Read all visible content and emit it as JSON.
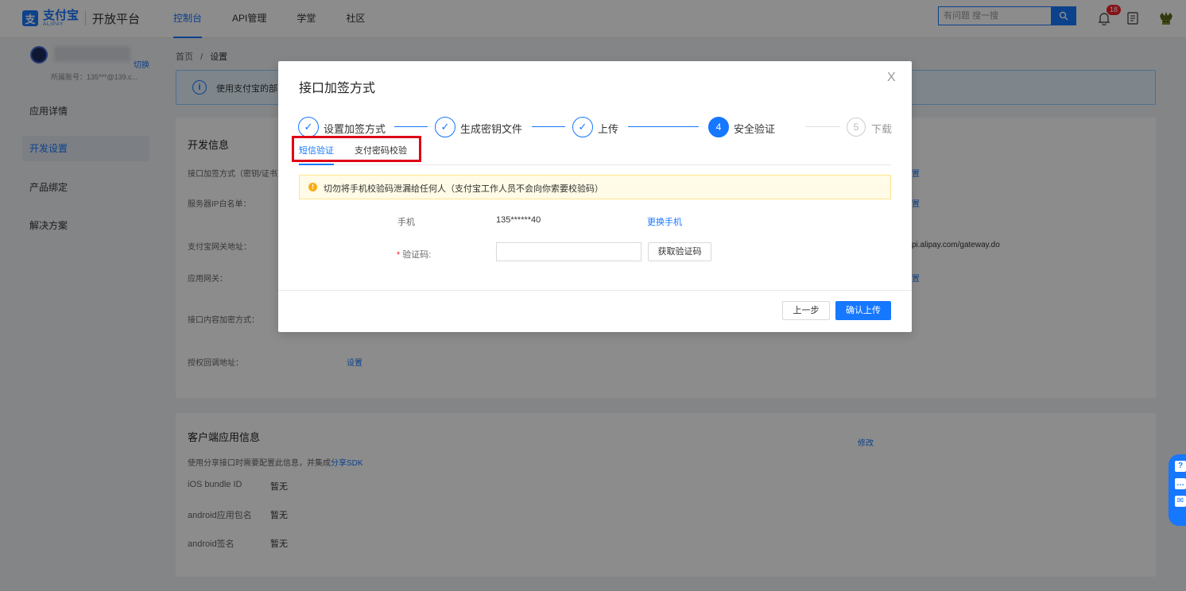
{
  "header": {
    "logo_cn": "支付宝",
    "logo_en": "ALIPAY",
    "platform": "开放平台",
    "nav": [
      "控制台",
      "API管理",
      "学堂",
      "社区"
    ],
    "search_placeholder": "有问题 搜一搜",
    "notification_count": "18"
  },
  "sidebar": {
    "switch": "切换",
    "account": "所属账号：135***@139.c...",
    "items": [
      "应用详情",
      "开发设置",
      "产品绑定",
      "解决方案"
    ]
  },
  "main": {
    "breadcrumb_home": "首页",
    "breadcrumb_sep": "/",
    "breadcrumb_current": "设置",
    "notice": "使用支付宝的部",
    "dev_card": {
      "title": "开发信息",
      "rows": [
        "接口加签方式（密钥/证书）",
        "服务器IP白名单：",
        "支付宝网关地址：",
        "应用网关：",
        "接口内容加密方式：",
        "授权回调地址："
      ],
      "gateway": "pi.alipay.com/gateway.do",
      "link_short": "置",
      "auth_set": "设置"
    },
    "client_card": {
      "title": "客户端应用信息",
      "modify": "修改",
      "desc_prefix": "使用分享接口时需要配置此信息，并集成",
      "desc_link": "分享SDK",
      "rows": [
        {
          "label": "iOS bundle ID",
          "value": "暂无"
        },
        {
          "label": "android应用包名",
          "value": "暂无"
        },
        {
          "label": "android签名",
          "value": "暂无"
        }
      ]
    }
  },
  "modal": {
    "title": "接口加签方式",
    "close": "X",
    "steps": [
      {
        "num": "✓",
        "label": "设置加签方式",
        "status": "done"
      },
      {
        "num": "✓",
        "label": "生成密钥文件",
        "status": "done"
      },
      {
        "num": "✓",
        "label": "上传",
        "status": "done"
      },
      {
        "num": "4",
        "label": "安全验证",
        "status": "current"
      },
      {
        "num": "5",
        "label": "下载",
        "status": "wait"
      }
    ],
    "tabs": [
      "短信验证",
      "支付密码校验"
    ],
    "warning": "切勿将手机校验码泄漏给任何人（支付宝工作人员不会向你索要校验码）",
    "phone_label": "手机",
    "phone_value": "135******40",
    "change_phone": "更换手机",
    "code_required": "*",
    "code_label": "验证码:",
    "get_code": "获取验证码",
    "prev": "上一步",
    "confirm": "确认上传"
  },
  "colors": {
    "primary": "#1677ff",
    "highlight": "#e00016",
    "warning": "#faad14"
  }
}
